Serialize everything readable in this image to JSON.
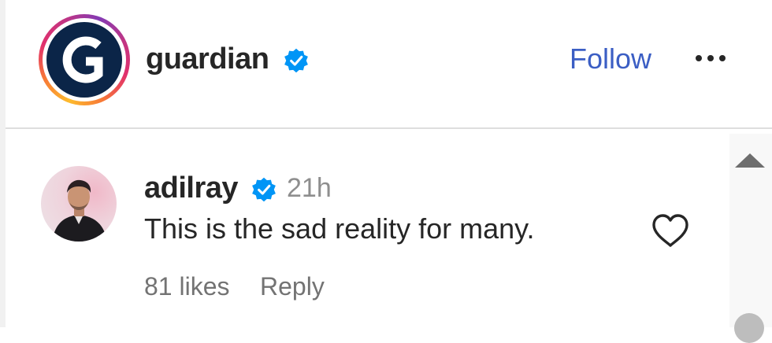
{
  "header": {
    "account_name": "guardian",
    "verified_icon": "verified-badge-icon",
    "follow_label": "Follow",
    "more_icon": "more-options-icon",
    "logo_icon": "guardian-logo-icon"
  },
  "comment": {
    "username": "adilray",
    "verified_icon": "verified-badge-icon",
    "time": "21h",
    "text": "This is the sad reality for many.",
    "like_icon": "heart-icon",
    "likes": "81 likes",
    "reply_label": "Reply"
  },
  "colors": {
    "follow_blue": "#3b5ec4",
    "verified_blue": "#0095f6",
    "logo_navy": "#0b2548"
  }
}
